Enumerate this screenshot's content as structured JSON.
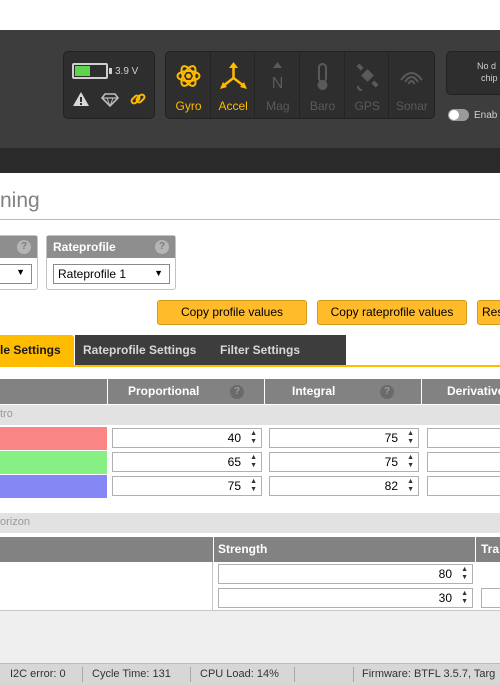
{
  "header": {
    "battery": {
      "voltage": "3.9 V",
      "level": 0.5,
      "fill_color": "#5ed34e"
    },
    "status_icons": [
      "warning-icon",
      "diamond-icon",
      "link-icon"
    ],
    "sensors": [
      {
        "label": "Gyro",
        "icon": "gyro-icon",
        "active": true
      },
      {
        "label": "Accel",
        "icon": "accel-icon",
        "active": true
      },
      {
        "label": "Mag",
        "icon": "mag-icon",
        "active": false
      },
      {
        "label": "Baro",
        "icon": "baro-icon",
        "active": false
      },
      {
        "label": "GPS",
        "icon": "gps-icon",
        "active": false
      },
      {
        "label": "Sonar",
        "icon": "sonar-icon",
        "active": false
      }
    ],
    "dataflash_line1": "No d",
    "dataflash_line2": "chip",
    "expert_toggle_label": "Enab"
  },
  "page": {
    "title": "ning"
  },
  "profile": {
    "selected": ""
  },
  "rateprofile": {
    "title": "Rateprofile",
    "selected": "Rateprofile 1"
  },
  "buttons": {
    "copy_profile": "Copy profile values",
    "copy_rateprofile": "Copy rateprofile values",
    "reset": "Res"
  },
  "tabs": [
    {
      "label": "le Settings",
      "active": true
    },
    {
      "label": "Rateprofile Settings",
      "active": false
    },
    {
      "label": "Filter Settings",
      "active": false
    }
  ],
  "pid_table": {
    "columns": [
      "Proportional",
      "Integral",
      "Derivative"
    ],
    "section": "tro",
    "rows": [
      {
        "color": "#fa8585",
        "p": "40",
        "i": "75"
      },
      {
        "color": "#86f084",
        "p": "65",
        "i": "75"
      },
      {
        "color": "#8587f5",
        "p": "75",
        "i": "82"
      }
    ]
  },
  "horizon": {
    "section": "orizon",
    "columns": [
      "Strength",
      "Tra"
    ],
    "values": [
      "80",
      "30"
    ]
  },
  "status_bar": {
    "i2c": "I2C error: 0",
    "cycle": "Cycle Time: 131",
    "cpu": "CPU Load: 14%",
    "firmware": "Firmware: BTFL 3.5.7, Targ"
  },
  "colors": {
    "accent": "#ffbb00",
    "header_bg": "#3d3d3d"
  }
}
